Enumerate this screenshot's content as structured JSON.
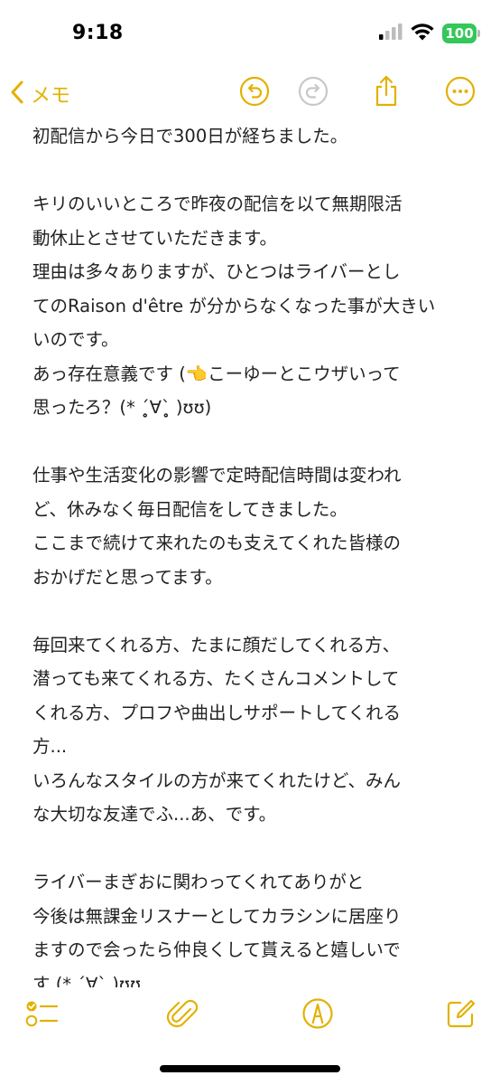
{
  "status_bar": {
    "time": "9:18",
    "battery": "100",
    "battery_color": "#34c759"
  },
  "nav": {
    "back_label": "メモ",
    "accent_color": "#e3b100",
    "icons": [
      "undo-icon",
      "redo-icon",
      "share-icon",
      "more-icon"
    ]
  },
  "note": {
    "lines": [
      "初配信から今日で300日が経ちました。",
      "",
      "キリのいいところで昨夜の配信を以て無期限活",
      "動休止とさせていただきます。",
      "理由は多々ありますが、ひとつはライバーとし",
      "てのRaison d'être が分からなくなった事が大きい",
      "いのです。",
      "あっ存在意義です (👈こーゆーとこウザいって",
      "思ったろ？(* ˊ̥̥̥̥̥∀ˋ̥̥̥̥̥ )ʊʊ)",
      "",
      "仕事や生活変化の影響で定時配信時間は変われ",
      "ど、休みなく毎日配信をしてきました。",
      "ここまで続けて来れたのも支えてくれた皆様の",
      "おかげだと思ってます。",
      "",
      "毎回来てくれる方、たまに顔だしてくれる方、",
      "潜っても来てくれる方、たくさんコメントして",
      "くれる方、プロフや曲出しサポートしてくれる",
      "方...",
      "いろんなスタイルの方が来てくれたけど、みん",
      "な大切な友達でふ...あ、です。",
      "",
      "ライバーまぎおに関わってくれてありがと",
      "今後は無課金リスナーとしてカラシンに居座り",
      "ますので会ったら仲良くして貰えると嬉しいで",
      "す (* ˊ̥̥̥̥̥∀ˋ̥̥̥̥̥ )ʊʊ"
    ]
  },
  "toolbar": {
    "icons": [
      "checklist-icon",
      "attachment-icon",
      "markup-icon",
      "compose-icon"
    ]
  }
}
